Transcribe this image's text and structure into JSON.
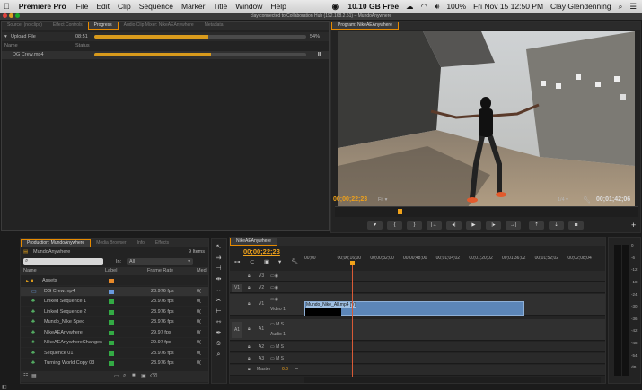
{
  "menubar": {
    "apple": "",
    "app_name": "Premiere Pro",
    "items": [
      "File",
      "Edit",
      "Clip",
      "Sequence",
      "Marker",
      "Title",
      "Window",
      "Help"
    ],
    "disk": "10.10 GB Free",
    "battery": "100%",
    "datetime": "Fri Nov 15  12:50 PM",
    "user": "Clay Glendenning"
  },
  "window_title": "clay connected to Collaboration Hub (192.168.2.51) – MundoAnywhere",
  "top_left_panel": {
    "tabs": [
      "Source: (no clips)",
      "Effect Controls",
      "Progress",
      "Audio Clip Mixer: NikeAEAnywhere",
      "Metadata"
    ],
    "active_tab": "Progress",
    "upload": {
      "label": "Upload File",
      "time": "08:51",
      "percent_text": "54%",
      "progress": 0.54
    },
    "columns": [
      "Name",
      "Status"
    ],
    "item": {
      "name": "DG Crew.mp4",
      "progress": 0.55,
      "pause": "II"
    }
  },
  "program_monitor": {
    "tab": "Program: NikeAEAnywhere",
    "timecode": "00;00;22;23",
    "fit": "Fit",
    "scale": "1/4",
    "duration": "00;01;42;06",
    "buttons": [
      "marker",
      "in",
      "out",
      "go-in",
      "step-back",
      "play",
      "step-fwd",
      "go-out",
      "lift",
      "extract",
      "camera"
    ]
  },
  "project_panel": {
    "tabs": [
      "Production: MundoAnywhere",
      "Media Browser",
      "Info",
      "Effects"
    ],
    "project_name": "MundoAnywhere",
    "item_count": "9 Items",
    "in_label": "In:",
    "in_value": "All",
    "columns": [
      "Name",
      "Label",
      "Frame Rate",
      "Medi"
    ],
    "items": [
      {
        "name": "Assets",
        "color": "#e88a2a",
        "rate": "",
        "m": "",
        "type": "folder"
      },
      {
        "name": "DG Crew.mp4",
        "color": "#6a9adf",
        "rate": "23.976 fps",
        "m": "0(",
        "type": "clip"
      },
      {
        "name": "Linked Sequence 1",
        "color": "#33aa44",
        "rate": "23.976 fps",
        "m": "0(",
        "type": "seq"
      },
      {
        "name": "Linked Sequence 2",
        "color": "#33aa44",
        "rate": "23.976 fps",
        "m": "0(",
        "type": "seq"
      },
      {
        "name": "Mundo_Nike Spec",
        "color": "#33aa44",
        "rate": "23.976 fps",
        "m": "0(",
        "type": "seq"
      },
      {
        "name": "NikeAEAnywhere",
        "color": "#33aa44",
        "rate": "29.97 fps",
        "m": "0(",
        "type": "seq"
      },
      {
        "name": "NikeAEAnywhereChanges",
        "color": "#33aa44",
        "rate": "29.97 fps",
        "m": "0(",
        "type": "seq"
      },
      {
        "name": "Sequence 01",
        "color": "#33aa44",
        "rate": "23.976 fps",
        "m": "0(",
        "type": "seq"
      },
      {
        "name": "Turning World Copy 03",
        "color": "#33aa44",
        "rate": "23.976 fps",
        "m": "0(",
        "type": "seq"
      }
    ]
  },
  "timeline": {
    "tab": "NikeAEAnywhere",
    "timecode": "00;00;22;23",
    "ruler": [
      "00;00",
      "00;00;16;00",
      "00;00;32;00",
      "00;00;48;00",
      "00;01;04;02",
      "00;01;20;02",
      "00;01;36;02",
      "00;01;52;02",
      "00;02;08;04"
    ],
    "video_tracks": [
      "V3",
      "V2",
      "V1"
    ],
    "audio_tracks": [
      "A1",
      "A2",
      "A3"
    ],
    "source_v": "V1",
    "source_a": "A1",
    "video1_label": "Video 1",
    "audio1_label": "Audio 1",
    "master": "Master",
    "master_val": "0.0",
    "clip": "Mundo_Nike_All.mp4 [V]"
  },
  "meter": [
    "0",
    "-6",
    "-12",
    "-18",
    "-24",
    "-30",
    "-36",
    "-42",
    "-48",
    "-54",
    "dB"
  ],
  "colors": {
    "accent": "#e68a00",
    "playhead": "#d85a36",
    "clip": "#5c86b8"
  }
}
